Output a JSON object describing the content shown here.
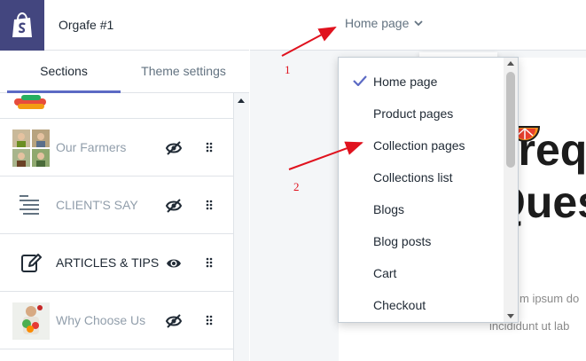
{
  "store": {
    "name": "Orgafe #1",
    "logo_icon": "shopify-bag-icon",
    "logo_color": "#43467f"
  },
  "tabs": [
    {
      "label": "Sections",
      "active": true
    },
    {
      "label": "Theme settings",
      "active": false
    }
  ],
  "accent_color": "#5c6ac4",
  "sections": [
    {
      "label": "",
      "visibility": "visible",
      "thumb": "fruit-image"
    },
    {
      "label": "Our Farmers",
      "visibility": "hidden",
      "thumb": "farmers-image"
    },
    {
      "label": "CLIENT'S SAY",
      "visibility": "hidden",
      "thumb": "text-lines-icon"
    },
    {
      "label": "ARTICLES & TIPS",
      "visibility": "visible",
      "thumb": "edit-note-icon"
    },
    {
      "label": "Why Choose Us",
      "visibility": "hidden",
      "thumb": "vegetables-image"
    }
  ],
  "page_selector": {
    "current": "Home page",
    "icon": "chevron-down-icon"
  },
  "dropdown": {
    "items": [
      {
        "label": "Home page",
        "selected": true
      },
      {
        "label": "Product pages",
        "selected": false
      },
      {
        "label": "Collection pages",
        "selected": false
      },
      {
        "label": "Collections list",
        "selected": false
      },
      {
        "label": "Blogs",
        "selected": false
      },
      {
        "label": "Blog posts",
        "selected": false
      },
      {
        "label": "Cart",
        "selected": false
      },
      {
        "label": "Checkout",
        "selected": false
      }
    ]
  },
  "preview": {
    "heading_line_1": "Freq",
    "heading_line_2": "Ques",
    "body_line_1": "m ipsum do",
    "body_line_2": "incididunt ut lab"
  },
  "annotations": [
    {
      "number": "1",
      "color": "#e0121e"
    },
    {
      "number": "2",
      "color": "#e0121e"
    }
  ]
}
